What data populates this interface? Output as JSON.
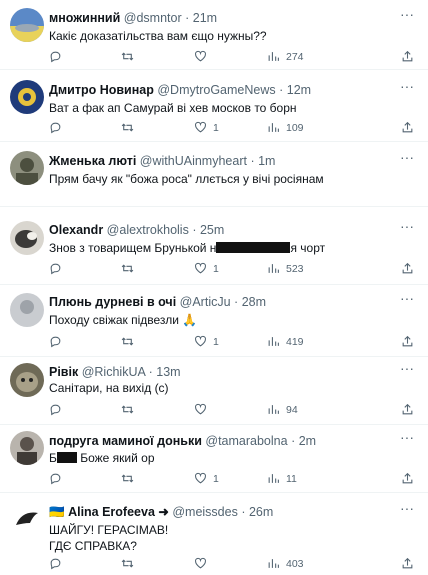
{
  "tweets": [
    {
      "name": "множинний",
      "handle": "@dsmntor",
      "time": "21m",
      "lines": [
        "Какіє доказатільства вам єщо нужны??"
      ],
      "counts": {
        "replies": "",
        "retweets": "",
        "likes": "",
        "views": "274"
      },
      "avatar": "avatar-flag-landscape"
    },
    {
      "name": "Дмитро Новинар",
      "handle": "@DmytroGameNews",
      "time": "12m",
      "lines": [
        "Ват а фак ап Самурай ві хев москов то борн"
      ],
      "counts": {
        "replies": "",
        "retweets": "",
        "likes": "1",
        "views": "109"
      },
      "avatar": "avatar-emblem"
    },
    {
      "name": "Жменька люті",
      "handle": "@withUAinmyheart",
      "time": "1m",
      "lines": [
        "Прям бачу як \"божа роса\" ллється у вічі росіянам"
      ],
      "counts": {
        "replies": "",
        "retweets": "",
        "likes": "",
        "views": ""
      },
      "avatar": "avatar-soldier"
    },
    {
      "name": "Olexandr",
      "handle": "@alextrokholis",
      "time": "25m",
      "lines": [
        "Знов з товарищем Брунькой н",
        "я чорт"
      ],
      "counts": {
        "replies": "",
        "retweets": "",
        "likes": "1",
        "views": "523"
      },
      "avatar": "avatar-dog"
    },
    {
      "name": "Плюнь дурневі в очі",
      "handle": "@ArticJu",
      "time": "28m",
      "lines": [
        "Походу свіжак підвезли 🙏"
      ],
      "counts": {
        "replies": "",
        "retweets": "",
        "likes": "1",
        "views": "419"
      },
      "avatar": "avatar-gray"
    },
    {
      "name": "Рівік",
      "handle": "@RichikUA",
      "time": "13m",
      "lines": [
        "Санітари, на вихід (с)"
      ],
      "counts": {
        "replies": "",
        "retweets": "",
        "likes": "",
        "views": "94"
      },
      "avatar": "avatar-cat"
    },
    {
      "name": "подруга маминої доньки",
      "handle": "@tamarabolna",
      "time": "2m",
      "lines": [
        "Б",
        " Боже який ор"
      ],
      "counts": {
        "replies": "",
        "retweets": "",
        "likes": "1",
        "views": "11"
      },
      "avatar": "avatar-person"
    },
    {
      "name": "Alina Erofeeva ➜",
      "handle": "@meissdes",
      "time": "26m",
      "lines": [
        "ШАЙГУ! ГЕРАСІМАВ!",
        "ГДЄ СПРАВКА?"
      ],
      "counts": {
        "replies": "",
        "retweets": "",
        "likes": "",
        "views": "403"
      },
      "avatar": "avatar-bird",
      "flag": "🇺🇦"
    }
  ],
  "colors": {
    "text": "#0f1419",
    "muted": "#536471",
    "divider": "#eff3f4"
  },
  "icons": [
    "reply-icon",
    "retweet-icon",
    "like-icon",
    "views-icon",
    "share-icon",
    "more-icon"
  ]
}
